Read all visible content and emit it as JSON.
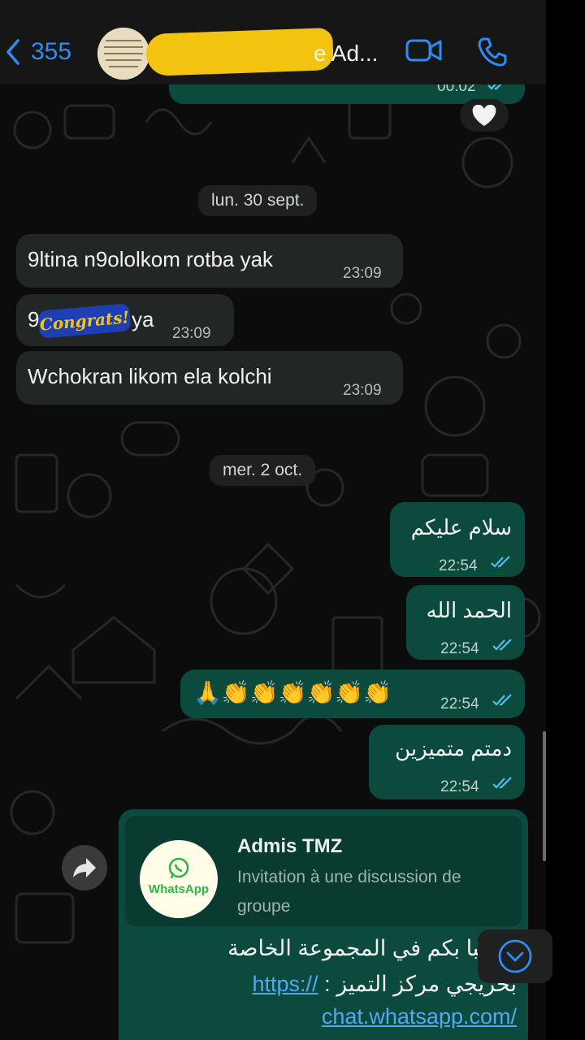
{
  "header": {
    "back_count": "355",
    "title": "e Ad..."
  },
  "top_message": {
    "time": "00:02"
  },
  "dates": {
    "first": "lun. 30 sept.",
    "second": "mer. 2 oct."
  },
  "incoming": [
    {
      "text": "9ltina n9ololkom rotba yak",
      "time": "23:09"
    },
    {
      "text_start": "9",
      "text_end": "ya",
      "time": "23:09",
      "sticker": "Congrats!"
    },
    {
      "text": "Wchokran likom ela kolchi",
      "time": "23:09"
    }
  ],
  "outgoing": [
    {
      "text": "سلام عليكم",
      "time": "22:54"
    },
    {
      "text": "الحمد الله",
      "time": "22:54"
    },
    {
      "text": "🙏👏👏👏👏👏👏",
      "time": "22:54"
    },
    {
      "text": "دمتم متميزين",
      "time": "22:54"
    }
  ],
  "invite_card": {
    "logo_text": "WhatsApp",
    "title": "Admis TMZ",
    "description": "Invitation à une discussion de groupe",
    "line1": "مرحبا بكم في المجموعة الخاصة",
    "line2_text": "بخريجي مركز التميز :",
    "line2_link": "https://",
    "line3_link": "chat.whatsapp.com/"
  },
  "colors": {
    "accent_blue": "#2f8cf3",
    "outgoing_bubble": "#0b4a3d",
    "incoming_bubble": "#222626",
    "read_ticks": "#53bdeb"
  },
  "icons": [
    "chevron-left-icon",
    "video-call-icon",
    "phone-icon",
    "heart-icon",
    "forward-icon",
    "chevron-down-icon",
    "double-tick-icon"
  ]
}
